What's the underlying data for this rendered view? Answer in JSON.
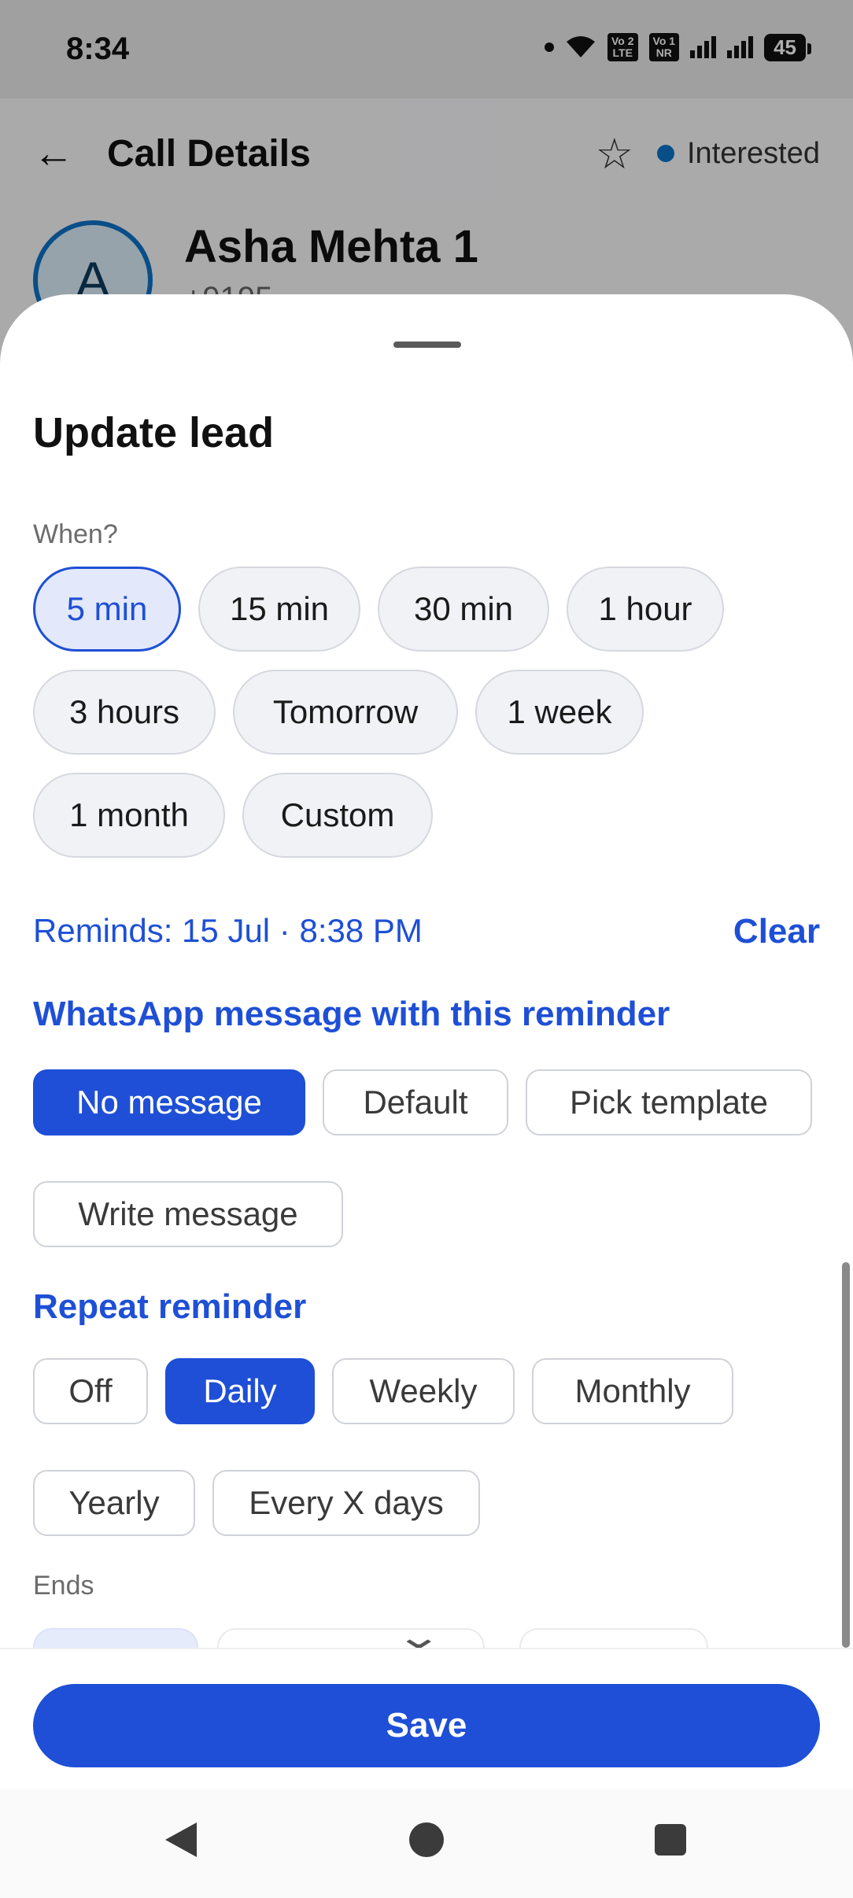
{
  "status_bar": {
    "time": "8:34",
    "vo1_line1": "Vo",
    "vo1_line2": "LTE",
    "vo1_sup": "2",
    "vo2_line1": "Vo",
    "vo2_line2": "NR",
    "vo2_sup": "1",
    "battery": "45"
  },
  "header": {
    "title": "Call Details",
    "status": "Interested"
  },
  "contact": {
    "avatar_letter": "A",
    "name": "Asha Mehta 1",
    "phone": "+9195"
  },
  "sheet": {
    "title": "Update lead",
    "when_label": "When?",
    "when_options": [
      "5 min",
      "15 min",
      "30 min",
      "1 hour",
      "3 hours",
      "Tomorrow",
      "1 week",
      "1 month",
      "Custom"
    ],
    "reminds_text": "Reminds: 15 Jul · 8:38 PM",
    "clear_label": "Clear",
    "whatsapp_title": "WhatsApp message with this reminder",
    "message_options": [
      "No message",
      "Default",
      "Pick template",
      "Write message"
    ],
    "repeat_title": "Repeat reminder",
    "repeat_options": [
      "Off",
      "Daily",
      "Weekly",
      "Monthly",
      "Yearly",
      "Every X days"
    ],
    "ends_label": "Ends",
    "save_label": "Save"
  },
  "colors": {
    "accent": "#1e4fd6",
    "status_dot": "#0d74c9"
  }
}
